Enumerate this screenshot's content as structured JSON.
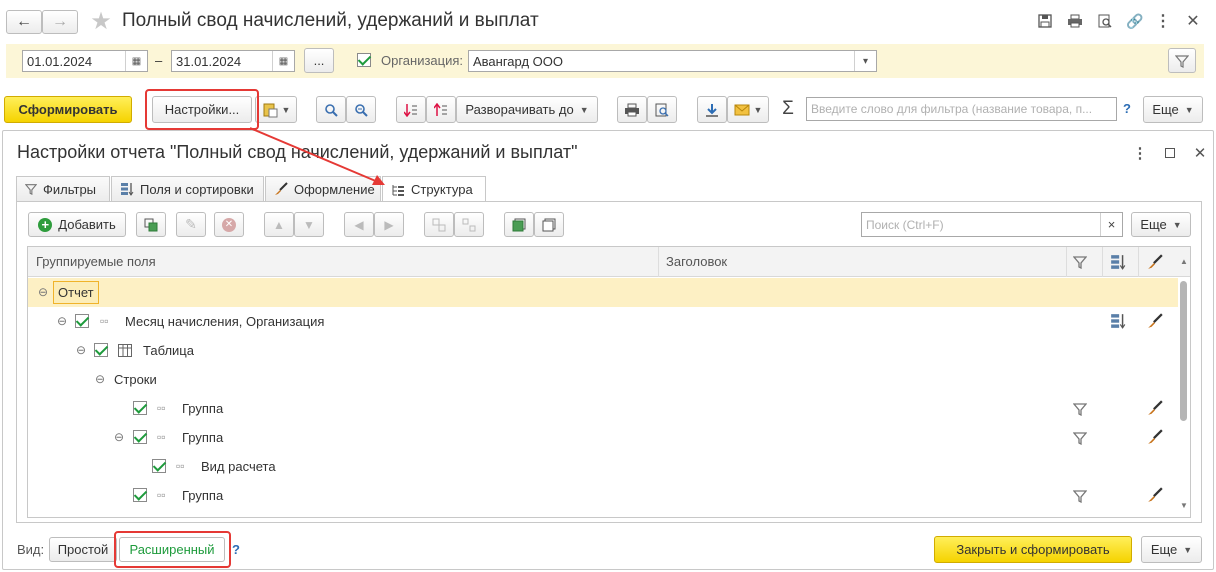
{
  "window": {
    "title": "Полный свод начислений, удержаний и выплат"
  },
  "period": {
    "from": "01.01.2024",
    "dash": "–",
    "to": "31.01.2024",
    "more": "..."
  },
  "organization": {
    "label": "Организация:",
    "value": "Авангард ООО"
  },
  "toolbar": {
    "generate": "Сформировать",
    "settings": "Настройки...",
    "expand_to": "Разворачивать до",
    "search_placeholder": "Введите слово для фильтра (название товара, п...",
    "help": "?",
    "more": "Еще"
  },
  "settings_panel": {
    "title": "Настройки отчета \"Полный свод начислений, удержаний и выплат\"",
    "tabs": [
      "Фильтры",
      "Поля и сортировки",
      "Оформление",
      "Структура"
    ],
    "add": "Добавить",
    "search_placeholder": "Поиск (Ctrl+F)",
    "clear": "×",
    "more": "Еще",
    "columns": [
      "Группируемые поля",
      "Заголовок"
    ],
    "rows": [
      "Отчет",
      "Месяц начисления, Организация",
      "Таблица",
      "Строки",
      "Группа",
      "Группа",
      "Вид расчета",
      "Группа"
    ]
  },
  "footer": {
    "view_label": "Вид:",
    "simple": "Простой",
    "extended": "Расширенный",
    "help": "?",
    "close_and_generate": "Закрыть и сформировать",
    "more": "Еще"
  },
  "colors": {
    "accent_yellow": "#f5d300",
    "highlight_red": "#e53935",
    "check_green": "#1e9b3c",
    "selected_row": "#fdf0c4"
  }
}
